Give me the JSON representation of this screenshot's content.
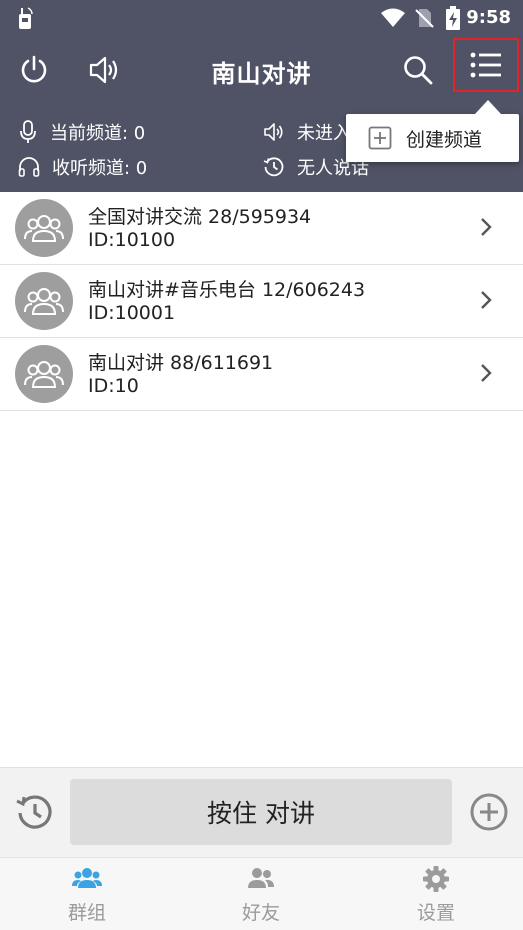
{
  "statusbar": {
    "time": "9:58"
  },
  "appbar": {
    "title": "南山对讲"
  },
  "info": {
    "current_channel": "当前频道: 0",
    "listen_channel": "收听频道: 0",
    "enter_status": "未进入",
    "speaker_status": "无人说话"
  },
  "popup": {
    "create_channel": "创建频道"
  },
  "channels": [
    {
      "name": "全国对讲交流 28/595934",
      "id": "ID:10100"
    },
    {
      "name": "南山对讲#音乐电台 12/606243",
      "id": "ID:10001"
    },
    {
      "name": "南山对讲 88/611691",
      "id": "ID:10"
    }
  ],
  "ptt": {
    "label": "按住 对讲"
  },
  "tabs": [
    {
      "label": "群组",
      "icon": "group-icon",
      "active": true
    },
    {
      "label": "好友",
      "icon": "friends-icon",
      "active": false
    },
    {
      "label": "设置",
      "icon": "gear-icon",
      "active": false
    }
  ],
  "colors": {
    "header": "#4f5365",
    "accent": "#3aa3e3",
    "menu_highlight": "#e0242a",
    "avatar": "#9e9e9e"
  }
}
